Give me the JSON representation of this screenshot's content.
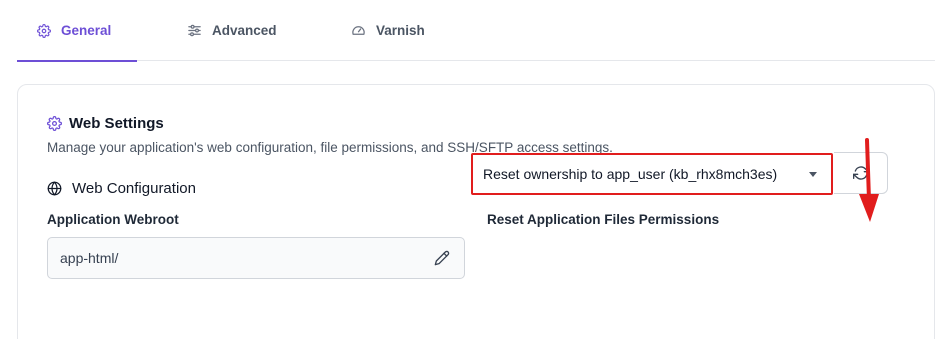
{
  "tabs": [
    {
      "label": "General",
      "icon": "gear-icon",
      "active": true
    },
    {
      "label": "Advanced",
      "icon": "sliders-icon",
      "active": false
    },
    {
      "label": "Varnish",
      "icon": "speedometer-icon",
      "active": false
    }
  ],
  "card": {
    "title": "Web Settings",
    "description": "Manage your application's web configuration, file permissions, and SSH/SFTP access settings.",
    "section_title": "Web Configuration",
    "webroot": {
      "label": "Application Webroot",
      "value": "app-html/"
    },
    "reset_permissions": {
      "label": "Reset Application Files Permissions",
      "selected": "Reset ownership to app_user (kb_rhx8mch3es)"
    }
  },
  "colors": {
    "accent": "#6d4fd6",
    "highlight": "#e11d1d"
  }
}
